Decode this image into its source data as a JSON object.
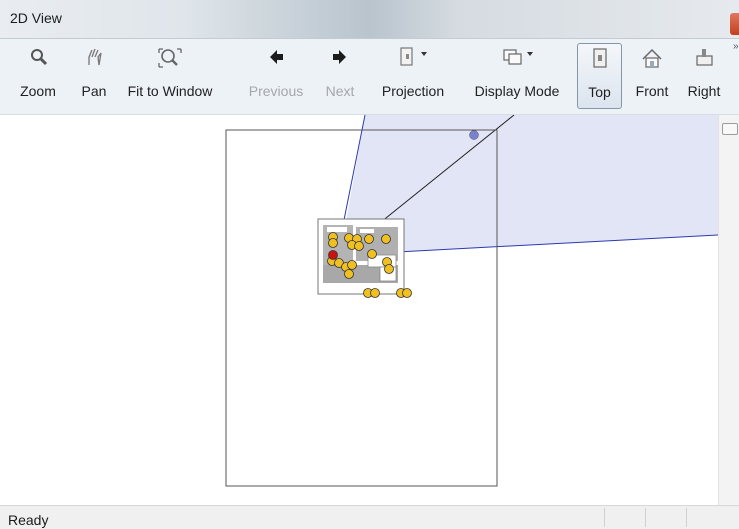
{
  "window": {
    "title": "2D View"
  },
  "toolbar": {
    "zoom": "Zoom",
    "pan": "Pan",
    "fit": "Fit to Window",
    "previous": "Previous",
    "next": "Next",
    "projection": "Projection",
    "display_mode": "Display Mode",
    "top": "Top",
    "front": "Front",
    "right": "Right"
  },
  "icons": {
    "zoom": "magnifier-icon",
    "pan": "hand-icon",
    "fit": "fit-window-icon",
    "previous": "arrow-left-icon",
    "next": "arrow-right-icon",
    "projection": "projection-icon",
    "display_mode": "display-mode-icon",
    "top": "top-view-icon",
    "front": "house-icon",
    "right": "right-view-icon"
  },
  "status": {
    "text": "Ready"
  },
  "colors": {
    "accent": "#8a8fd6",
    "marker": "#f0c020",
    "selected_marker": "#cc1111",
    "view_cone": "#dde0f5"
  }
}
